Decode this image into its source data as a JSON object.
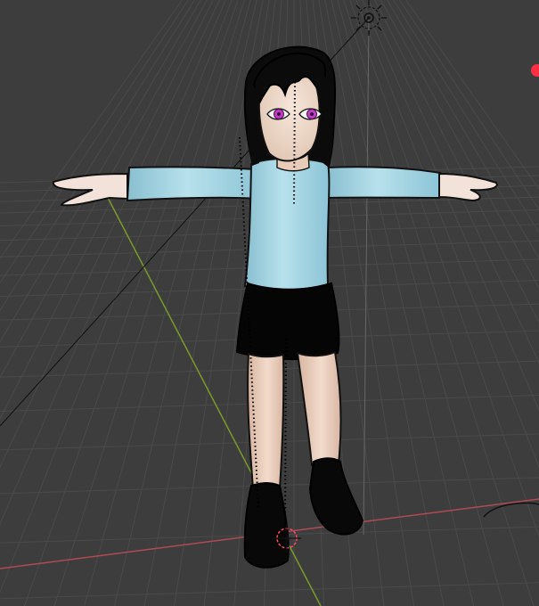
{
  "viewport": {
    "background": "#3d3d3d",
    "grid_color": "#4a4a4a",
    "x_axis_color": "#b04a55",
    "y_axis_color": "#7a9a2a"
  },
  "character": {
    "skin_color": "#f0d5c3",
    "shirt_color": "#a9d6e3",
    "skirt_color": "#050505",
    "hair_color": "#0b0b0b",
    "boot_color": "#080808",
    "eye_color": "#c13cc7"
  },
  "objects": {
    "light": "light-icon",
    "origin": "object-origin-icon",
    "camera_marker": "red-point-icon"
  }
}
